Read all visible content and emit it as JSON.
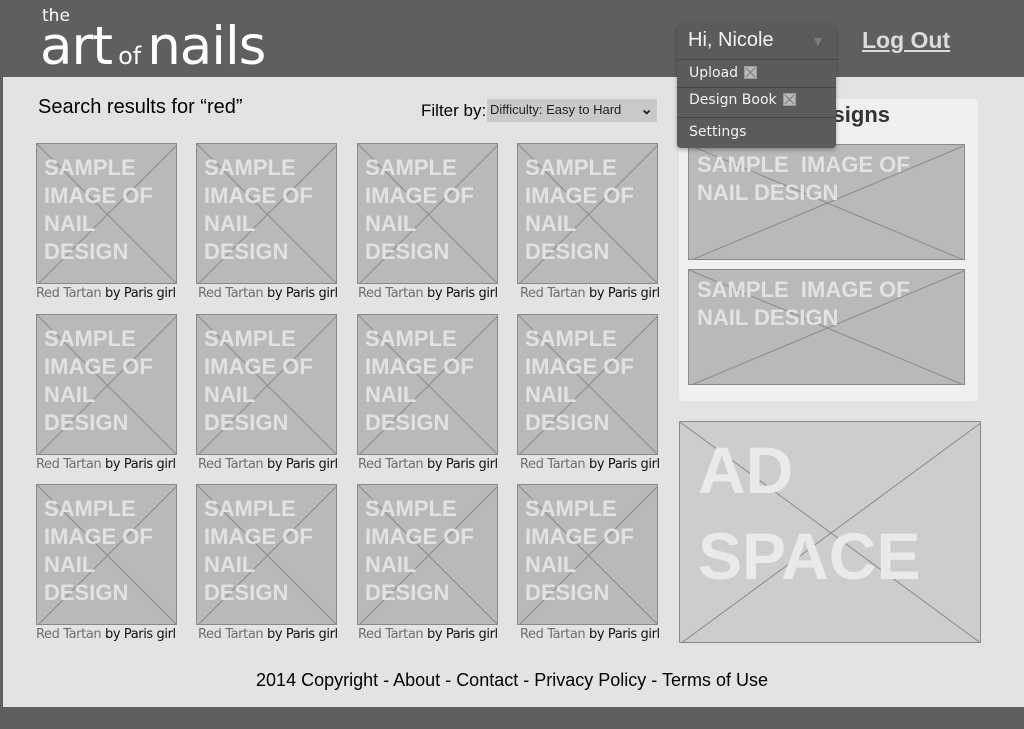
{
  "header": {
    "logo": {
      "the": "the",
      "art": "art",
      "of": "of",
      "nails": "nails"
    },
    "logout_label": "Log Out"
  },
  "user_menu": {
    "greeting": "Hi, Nicole",
    "caret_icon": "triangle-down-icon",
    "items": [
      {
        "label": "Upload",
        "icon": "image-placeholder-icon"
      },
      {
        "label": "Design Book",
        "icon": "image-placeholder-icon"
      },
      {
        "label": "Settings"
      }
    ]
  },
  "search": {
    "title": "Search results for “red”",
    "filter_label": "Filter by:",
    "filter_value": "Difficulty: Easy to Hard"
  },
  "results": [
    {
      "image_text": "SAMPLE IMAGE OF NAIL DESIGN",
      "title": "Red Tartan",
      "by": "by Paris girl"
    },
    {
      "image_text": "SAMPLE IMAGE OF NAIL DESIGN",
      "title": "Red Tartan",
      "by": "by Paris girl"
    },
    {
      "image_text": "SAMPLE IMAGE OF NAIL DESIGN",
      "title": "Red Tartan",
      "by": "by Paris girl"
    },
    {
      "image_text": "SAMPLE IMAGE OF NAIL DESIGN",
      "title": "Red Tartan",
      "by": "by Paris girl"
    },
    {
      "image_text": "SAMPLE IMAGE OF NAIL DESIGN",
      "title": "Red Tartan",
      "by": "by Paris girl"
    },
    {
      "image_text": "SAMPLE IMAGE OF NAIL DESIGN",
      "title": "Red Tartan",
      "by": "by Paris girl"
    },
    {
      "image_text": "SAMPLE IMAGE OF NAIL DESIGN",
      "title": "Red Tartan",
      "by": "by Paris girl"
    },
    {
      "image_text": "SAMPLE IMAGE OF NAIL DESIGN",
      "title": "Red Tartan",
      "by": "by Paris girl"
    },
    {
      "image_text": "SAMPLE IMAGE OF NAIL DESIGN",
      "title": "Red Tartan",
      "by": "by Paris girl"
    },
    {
      "image_text": "SAMPLE IMAGE OF NAIL DESIGN",
      "title": "Red Tartan",
      "by": "by Paris girl"
    },
    {
      "image_text": "SAMPLE IMAGE OF NAIL DESIGN",
      "title": "Red Tartan",
      "by": "by Paris girl"
    },
    {
      "image_text": "SAMPLE IMAGE OF NAIL DESIGN",
      "title": "Red Tartan",
      "by": "by Paris girl"
    }
  ],
  "side_panel": {
    "title_visible": "signs",
    "items": [
      {
        "image_text": "SAMPLE  IMAGE OF NAIL DESIGN"
      },
      {
        "image_text": "SAMPLE  IMAGE OF NAIL DESIGN"
      }
    ]
  },
  "ad": {
    "text": "AD SPACE"
  },
  "footer": {
    "copyright": "2014 Copyright",
    "separator": " - ",
    "links": [
      "About",
      "Contact",
      "Privacy Policy",
      "Terms of Use"
    ]
  },
  "colors": {
    "header_bg": "#5e5f61",
    "page_bg": "#e3e3e3",
    "placeholder_bg": "#b9b9b9",
    "placeholder_text": "#e2e2e2"
  }
}
